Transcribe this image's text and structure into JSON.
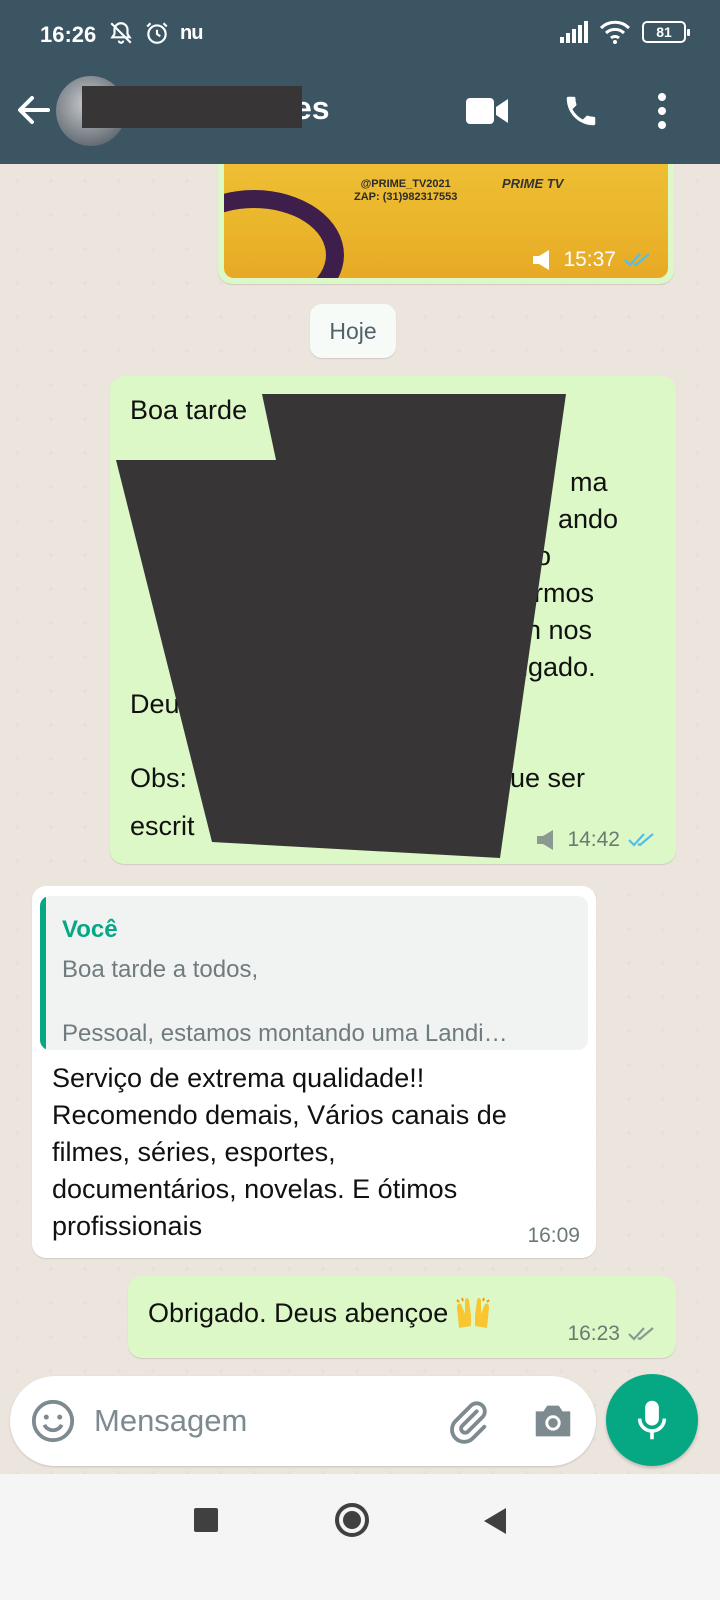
{
  "status_bar": {
    "time": "16:26",
    "carrier_icon": "nu",
    "battery": "81"
  },
  "header": {
    "contact_name_visible": "es"
  },
  "chat": {
    "image_message": {
      "image_handle": "@PRIME_TV2021\nZAP: (31)982317553",
      "image_brand": "PRIME TV",
      "time": "15:37",
      "status": "read"
    },
    "date_chip": "Hoje",
    "message_1": {
      "time": "14:42",
      "status": "read",
      "line_1": "Boa tarde",
      "line_2": "ma",
      "line_3": "ando",
      "line_4": "o",
      "line_5": "rmos",
      "line_6": "n nos",
      "line_7": "igado.",
      "line_8": "Deu",
      "line_9": "Obs:",
      "line_9b": "ue ser",
      "line_10": "escrit"
    },
    "message_2": {
      "quote_author": "Você",
      "quote_line_1": "Boa tarde a todos,",
      "quote_line_2": "Pessoal, estamos montando uma Landi…",
      "text": "Serviço de extrema qualidade!!\nRecomendo demais, Vários canais de\nfilmes, séries, esportes,\ndocumentários, novelas. E ótimos\nprofissionais",
      "time": "16:09"
    },
    "message_3": {
      "text": "Obrigado. Deus abençoe",
      "time": "16:23",
      "status": "delivered"
    }
  },
  "input": {
    "placeholder": "Mensagem"
  },
  "colors": {
    "header": "#3b5563",
    "outgoing_bubble": "#dcf8c6",
    "accent": "#06a884",
    "read_ticks": "#53bdeb"
  }
}
